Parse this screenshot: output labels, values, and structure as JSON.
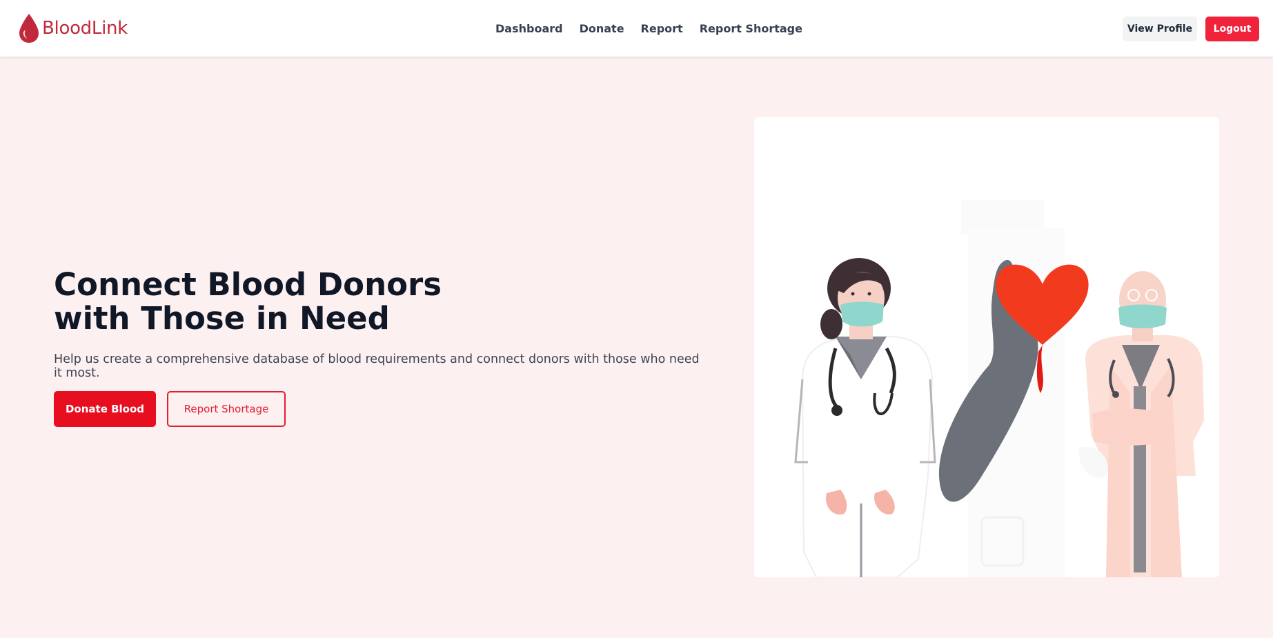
{
  "brand": {
    "name": "BloodLink",
    "icon": "blood-drop-icon",
    "color": "#c0293b"
  },
  "nav": {
    "links": [
      {
        "label": "Dashboard"
      },
      {
        "label": "Donate"
      },
      {
        "label": "Report"
      },
      {
        "label": "Report Shortage"
      }
    ]
  },
  "header": {
    "view_profile_label": "View Profile",
    "logout_label": "Logout"
  },
  "hero": {
    "title_line1": "Connect Blood Donors",
    "title_line2": "with Those in Need",
    "subtitle": "Help us create a comprehensive database of blood requirements and connect donors with those who need it most.",
    "primary_button": "Donate Blood",
    "secondary_button": "Report Shortage"
  },
  "colors": {
    "accent": "#e70e20",
    "page_background": "#fdf0f0",
    "heading": "#101828"
  },
  "illustration": {
    "icon": "doctors-with-heart-illustration"
  }
}
